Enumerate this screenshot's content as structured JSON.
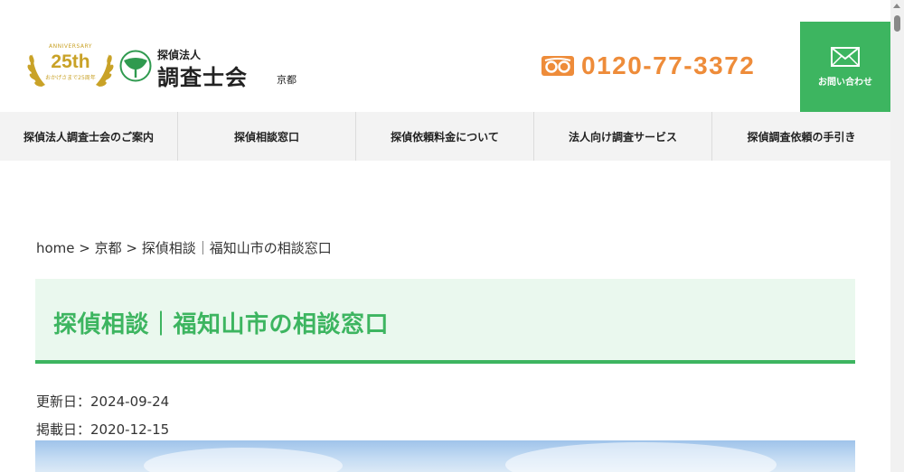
{
  "header": {
    "badge": {
      "top": "ANNIVERSARY",
      "number": "25th",
      "sub": "おかげさまで25周年"
    },
    "logo": {
      "small": "探偵法人",
      "main": "調査士会",
      "region": "京都"
    },
    "phone": {
      "number": "0120-77-3372"
    },
    "contact": {
      "label": "お問い合わせ"
    }
  },
  "nav": {
    "items": [
      {
        "label": "探偵法人調査士会のご案内"
      },
      {
        "label": "探偵相談窓口"
      },
      {
        "label": "探偵依頼料金について"
      },
      {
        "label": "法人向け調査サービス"
      },
      {
        "label": "探偵調査依頼の手引き"
      }
    ]
  },
  "breadcrumb": {
    "home": "home",
    "sep": " > ",
    "region": "京都",
    "current": "探偵相談｜福知山市の相談窓口"
  },
  "page": {
    "title": "探偵相談｜福知山市の相談窓口",
    "updated": "更新日：2024-09-24",
    "posted": "掲載日：2020-12-15"
  },
  "colors": {
    "accent": "#3db560",
    "phone": "#ee8c3a",
    "gold": "#c9a227",
    "title_bg": "#eaf8ee"
  }
}
